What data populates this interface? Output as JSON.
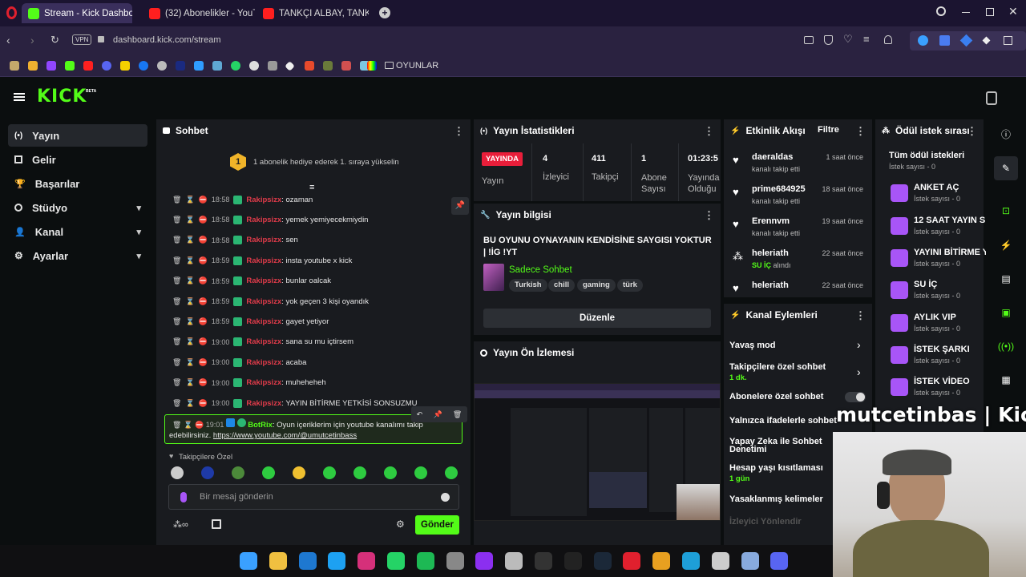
{
  "browser": {
    "tabs": [
      {
        "title": "Stream - Kick Dashboard"
      },
      {
        "title": "(32) Abonelikler - YouTube"
      },
      {
        "title": "TANKÇI ALBAY, TANK SAVAŞ"
      }
    ],
    "vpn": "VPN",
    "url": "dashboard.kick.com/stream",
    "bookmark_folder": "OYUNLAR"
  },
  "brand": {
    "logo": "KICK",
    "beta": "BETA"
  },
  "sidebar": {
    "items": [
      {
        "label": "Yayın"
      },
      {
        "label": "Gelir"
      },
      {
        "label": "Başarılar"
      },
      {
        "label": "Stüdyo"
      },
      {
        "label": "Kanal"
      },
      {
        "label": "Ayarlar"
      }
    ]
  },
  "chat": {
    "title": "Sohbet",
    "gift_rank": "1",
    "gift_text": "1 abonelik hediye ederek 1. sıraya yükselin",
    "messages": [
      {
        "time": "18:58",
        "user": "Rakipsizx",
        "text": ": ozaman"
      },
      {
        "time": "18:58",
        "user": "Rakipsizx",
        "text": ": yemek yemiyecekmiydin"
      },
      {
        "time": "18:58",
        "user": "Rakipsizx",
        "text": ": sen"
      },
      {
        "time": "18:59",
        "user": "Rakipsizx",
        "text": ": insta youtube x kick"
      },
      {
        "time": "18:59",
        "user": "Rakipsizx",
        "text": ": bunlar oalcak"
      },
      {
        "time": "18:59",
        "user": "Rakipsizx",
        "text": ": yok geçen 3 kişi oyandık"
      },
      {
        "time": "18:59",
        "user": "Rakipsizx",
        "text": ": gayet yetiyor"
      },
      {
        "time": "19:00",
        "user": "Rakipsizx",
        "text": ": sana su mu içtirsem"
      },
      {
        "time": "19:00",
        "user": "Rakipsizx",
        "text": ": acaba"
      },
      {
        "time": "19:00",
        "user": "Rakipsizx",
        "text": ": muheheheh"
      },
      {
        "time": "19:00",
        "user": "Rakipsizx",
        "text": ": YAYIN BİTİRME YETKİSİ SONSUZMU"
      }
    ],
    "bot_message": {
      "time": "19:01",
      "user": "BotRix",
      "text_line1": ": Oyun içeriklerim için youtube kanalımı takip",
      "text_line2": "edebilirsiniz.",
      "link": "https://www.youtube.com/@umutcetinbass"
    },
    "emote_section": "Takipçilere Özel",
    "input_placeholder": "Bir mesaj gönderin",
    "send_label": "Gönder"
  },
  "stats": {
    "title": "Yayın İstatistikleri",
    "live_badge": "YAYINDA",
    "live_sub": "Yayın",
    "items": [
      {
        "value": "4",
        "label": "İzleyici"
      },
      {
        "value": "411",
        "label": "Takipçi"
      },
      {
        "value": "1",
        "label": "Abone\nSayısı"
      },
      {
        "value": "01:23:5",
        "label": "Yayında\nOlduğu"
      }
    ]
  },
  "stream_info": {
    "title": "Yayın bilgisi",
    "stream_title": "BU OYUNU OYNAYANIN KENDİSİNE SAYGISI YOKTUR | !İG !YT",
    "category": "Sadece Sohbet",
    "tags": [
      "Turkish",
      "chill",
      "gaming",
      "türk"
    ],
    "edit_label": "Düzenle"
  },
  "preview": {
    "title": "Yayın Ön İzlemesi"
  },
  "activity": {
    "title": "Etkinlik Akışı",
    "filter": "Filtre",
    "events": [
      {
        "user": "daeraldas",
        "action": "kanalı takip etti",
        "time": "1 saat önce"
      },
      {
        "user": "prime684925",
        "action": "kanalı takip etti",
        "time": "18 saat önce"
      },
      {
        "user": "Erennvm",
        "action": "kanalı takip etti",
        "time": "19 saat önce"
      },
      {
        "user": "heleriath",
        "action": "alındı",
        "reward": "SU İÇ",
        "time": "22 saat önce"
      },
      {
        "user": "heleriath",
        "action": "",
        "time": "22 saat önce"
      }
    ]
  },
  "channel_actions": {
    "title": "Kanal Eylemleri",
    "items": [
      {
        "label": "Yavaş mod",
        "sub": ""
      },
      {
        "label": "Takipçilere özel sohbet",
        "sub": "1 dk."
      },
      {
        "label": "Abonelere özel sohbet",
        "sub": ""
      },
      {
        "label": "Yalnızca ifadelerle sohbet",
        "sub": ""
      },
      {
        "label": "Yapay Zeka ile Sohbet Denetimi",
        "sub": ""
      },
      {
        "label": "Hesap yaşı kısıtlaması",
        "sub": "1 gün"
      },
      {
        "label": "Yasaklanmış kelimeler",
        "sub": ""
      },
      {
        "label": "İzleyici Yönlendir",
        "sub": ""
      }
    ]
  },
  "rewards": {
    "title": "Ödül istek sırası",
    "items": [
      {
        "title": "Tüm ödül istekleri",
        "sub": "İstek sayısı - 0"
      },
      {
        "title": "ANKET AÇ",
        "sub": "İstek sayısı - 0"
      },
      {
        "title": "12 SAAT YAYIN S",
        "sub": "İstek sayısı - 0"
      },
      {
        "title": "YAYINI BİTİRME Y",
        "sub": "İstek sayısı - 0"
      },
      {
        "title": "SU İÇ",
        "sub": "İstek sayısı - 0"
      },
      {
        "title": "AYLIK VIP",
        "sub": "İstek sayısı - 0"
      },
      {
        "title": "İSTEK ŞARKI",
        "sub": "İstek sayısı - 0"
      },
      {
        "title": "İSTEK VİDEO",
        "sub": "İstek sayısı - 0"
      }
    ]
  },
  "overlay": {
    "text": "mutcetinbas | Kic"
  }
}
